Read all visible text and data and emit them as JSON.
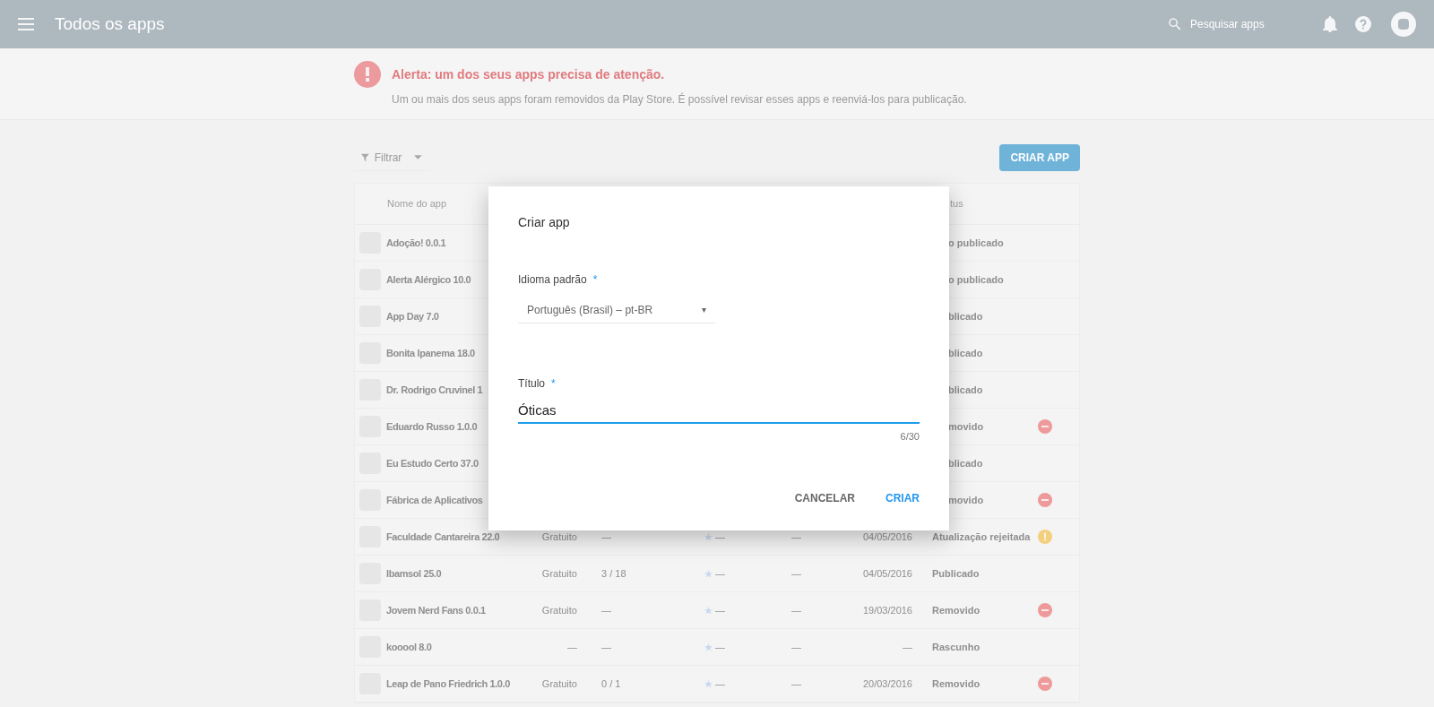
{
  "top_bar": {
    "title": "Todos os apps",
    "search_placeholder": "Pesquisar apps"
  },
  "alert": {
    "title": "Alerta: um dos seus apps precisa de atenção.",
    "message": "Um ou mais dos seus apps foram removidos da Play Store. É possível revisar esses apps e reenviá-los para publicação."
  },
  "toolbar": {
    "filter_label": "Filtrar",
    "create_button": "CRIAR APP"
  },
  "table": {
    "columns": [
      {
        "label": "Nome do app",
        "kind": "name"
      },
      {
        "label": "tus",
        "kind": "status"
      }
    ],
    "rows": [
      {
        "kind": "behind_dialog",
        "name": "Adoção! 0.0.1",
        "status": "o publicado"
      },
      {
        "kind": "behind_dialog",
        "name": "Alerta Alérgico 10.0",
        "status": "o publicado"
      },
      {
        "kind": "behind_dialog",
        "name": "App Day 7.0",
        "status": "blicado"
      },
      {
        "kind": "behind_dialog",
        "name": "Bonita Ipanema 18.0",
        "status": "blicado"
      },
      {
        "kind": "behind_dialog",
        "name": "Dr. Rodrigo Cruvinel 1",
        "status": "blicado"
      },
      {
        "kind": "behind_dialog",
        "name": "Eduardo Russo 1.0.0",
        "status": "movido",
        "status_icon": {
          "kind": "removed"
        }
      },
      {
        "kind": "behind_dialog",
        "name": "Eu Estudo Certo 37.0",
        "status": "blicado"
      },
      {
        "kind": "behind_dialog",
        "name": "Fábrica de Aplicativos",
        "status": "movido",
        "status_icon": {
          "kind": "removed"
        }
      },
      {
        "kind": "full",
        "name": "Faculdade Cantareira 22.0",
        "price": "Gratuito",
        "installs": "—",
        "rating": "—",
        "column_5": "—",
        "date": "04/05/2016",
        "status": "Atualização rejeitada",
        "status_icon": {
          "kind": "warning"
        }
      },
      {
        "kind": "full",
        "name": "Ibamsol 25.0",
        "price": "Gratuito",
        "installs": "3 / 18",
        "rating": "—",
        "column_5": "—",
        "date": "04/05/2016",
        "status": "Publicado"
      },
      {
        "kind": "full",
        "name": "Jovem Nerd Fans 0.0.1",
        "price": "Gratuito",
        "installs": "—",
        "rating": "—",
        "column_5": "—",
        "date": "19/03/2016",
        "status": "Removido",
        "status_icon": {
          "kind": "removed"
        }
      },
      {
        "kind": "full",
        "name": "kooool 8.0",
        "price": "—",
        "installs": "—",
        "rating": "—",
        "column_5": "—",
        "date": "—",
        "status": "Rascunho"
      },
      {
        "kind": "full",
        "name": "Leap de Pano Friedrich 1.0.0",
        "price": "Gratuito",
        "installs": "0 / 1",
        "rating": "—",
        "column_5": "—",
        "date": "20/03/2016",
        "status": "Removido",
        "status_icon": {
          "kind": "removed"
        }
      }
    ]
  },
  "dialog": {
    "title": "Criar app",
    "language": {
      "label": "Idioma padrão",
      "required": "*",
      "value": "Português (Brasil) – pt-BR",
      "caret": "▾"
    },
    "title_field": {
      "label": "Título",
      "required": "*",
      "value": "Óticas",
      "counter": "6/30",
      "focused": true
    },
    "buttons": [
      {
        "label": "CANCELAR",
        "kind": "secondary"
      },
      {
        "label": "CRIAR",
        "kind": "primary"
      }
    ]
  }
}
